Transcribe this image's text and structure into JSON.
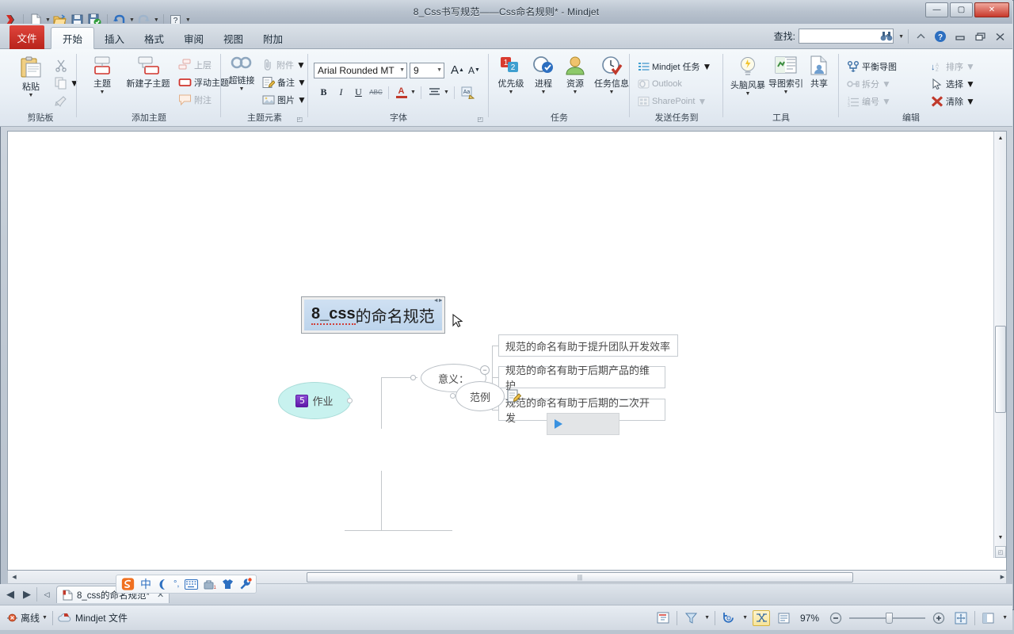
{
  "window": {
    "title": "8_Css书写规范——Css命名规则* - Mindjet",
    "minimize_label": "—",
    "maximize_label": "▢",
    "close_label": "✕"
  },
  "quick_access": {
    "items": [
      {
        "name": "app-menu-icon",
        "label": "M"
      },
      {
        "name": "new-document-icon",
        "label": "New"
      },
      {
        "name": "new-dropdown-icon",
        "label": "▾"
      },
      {
        "name": "open-icon",
        "label": "Open"
      },
      {
        "name": "save-icon",
        "label": "Save"
      },
      {
        "name": "save-check-icon",
        "label": "Save & Check"
      },
      {
        "name": "undo-icon",
        "label": "Undo"
      },
      {
        "name": "undo-dropdown-icon",
        "label": "▾"
      },
      {
        "name": "redo-icon",
        "label": "Redo"
      },
      {
        "name": "redo-dropdown-icon",
        "label": "▾"
      },
      {
        "name": "help-icon",
        "label": "?"
      },
      {
        "name": "customize-qat-icon",
        "label": "▾"
      }
    ]
  },
  "ribbon": {
    "tabs": [
      {
        "label": "文件",
        "key": "file"
      },
      {
        "label": "开始",
        "key": "home"
      },
      {
        "label": "插入",
        "key": "insert"
      },
      {
        "label": "格式",
        "key": "format"
      },
      {
        "label": "审阅",
        "key": "review"
      },
      {
        "label": "视图",
        "key": "view"
      },
      {
        "label": "附加",
        "key": "addins"
      }
    ],
    "active_tab": "开始",
    "find": {
      "label": "查找:",
      "value": "",
      "placeholder": ""
    },
    "groups": {
      "clipboard": {
        "title": "剪贴板",
        "paste": "粘贴",
        "cut": "剪切",
        "copy": "复制",
        "format_painter": "格式刷"
      },
      "add_topic": {
        "title": "添加主题",
        "topic": "主题",
        "new_subtopic": "新建子主题",
        "upper_level": "上层",
        "floating_topic": "浮动主题",
        "callout": "附注"
      },
      "topic_elements": {
        "title": "主题元素",
        "hyperlink": "超链接",
        "attachment": "附件",
        "note": "备注",
        "image": "图片"
      },
      "font": {
        "title": "字体",
        "font_name": "Arial Rounded MT",
        "font_size": "9",
        "grow_font": "A",
        "shrink_font": "A",
        "bold": "B",
        "italic": "I",
        "underline": "U",
        "strikethrough": "ABC",
        "font_color": "A",
        "align": "≡",
        "text_style": "Aa"
      },
      "task": {
        "title": "任务",
        "priority": "优先级",
        "progress": "进程",
        "resource": "资源",
        "task_info": "任务信息"
      },
      "send_task": {
        "title": "发送任务到",
        "mindjet_task": "Mindjet 任务",
        "outlook": "Outlook",
        "sharepoint": "SharePoint"
      },
      "tools": {
        "title": "工具",
        "brainstorm": "头脑风暴",
        "map_index": "导图索引",
        "share": "共享"
      },
      "editing": {
        "title": "编辑",
        "balance_map": "平衡导图",
        "sort": "排序",
        "split": "拆分",
        "select": "选择",
        "numbering": "编号",
        "clear": "清除"
      }
    },
    "window_controls": {
      "help": "?",
      "minimize_ribbon": "^",
      "restore_doc": "▭",
      "maximize_doc": "▣",
      "close_doc": "✕"
    }
  },
  "mindmap": {
    "central_topic": {
      "text_spell": "8_css",
      "text_rest": "的命名规范"
    },
    "branches": [
      {
        "label": "意义：",
        "collapse_label": "−",
        "children": [
          "规范的命名有助于提升团队开发效率",
          "规范的命名有助于后期产品的维护",
          "规范的命名有助于后期的二次开发"
        ]
      },
      {
        "label": "作业",
        "badge": "5",
        "children": []
      },
      {
        "label": "范例",
        "note_icon": "note-icon",
        "children": []
      }
    ],
    "play_box": {
      "icon": "play-icon"
    }
  },
  "doc_tabs": {
    "back_label": "◀",
    "forward_label": "▶",
    "list_label": "◁",
    "tabs": [
      {
        "label": "8_css的命名规范*",
        "close": "✕"
      }
    ]
  },
  "status_bar": {
    "offline_label": "离线",
    "file_label": "Mindjet 文件",
    "zoom_level": "97%",
    "zoom_out": "−",
    "zoom_in": "+",
    "buttons": [
      {
        "name": "outline-view-button",
        "label": "outline-icon"
      },
      {
        "name": "filter-button",
        "label": "filter-icon"
      },
      {
        "name": "refresh-button",
        "label": "refresh-icon"
      },
      {
        "name": "balance-view-button",
        "label": "balance-icon"
      },
      {
        "name": "detail-view-button",
        "label": "detail-icon"
      },
      {
        "name": "fit-map-button",
        "label": "fit-icon"
      },
      {
        "name": "panel-toggle-button",
        "label": "panel-icon"
      }
    ]
  },
  "ime": {
    "items": [
      {
        "name": "sogou-logo-icon",
        "label": "S"
      },
      {
        "name": "chinese-mode-icon",
        "label": "中"
      },
      {
        "name": "crescent-icon",
        "label": "☽"
      },
      {
        "name": "punctuation-icon",
        "label": "°,"
      },
      {
        "name": "soft-keyboard-icon",
        "label": "⌨"
      },
      {
        "name": "toolbox-icon",
        "label": "tool"
      },
      {
        "name": "skin-icon",
        "label": "skin"
      },
      {
        "name": "settings-icon",
        "label": "wrench"
      }
    ]
  },
  "colors": {
    "accent_red": "#c8392c",
    "node_border": "#c0c5ca",
    "node_text": "#4a4a4a",
    "center_fill": "#bcd4ec",
    "cyan_fill": "#c8f2ef",
    "badge_purple": "#5e18a8"
  }
}
